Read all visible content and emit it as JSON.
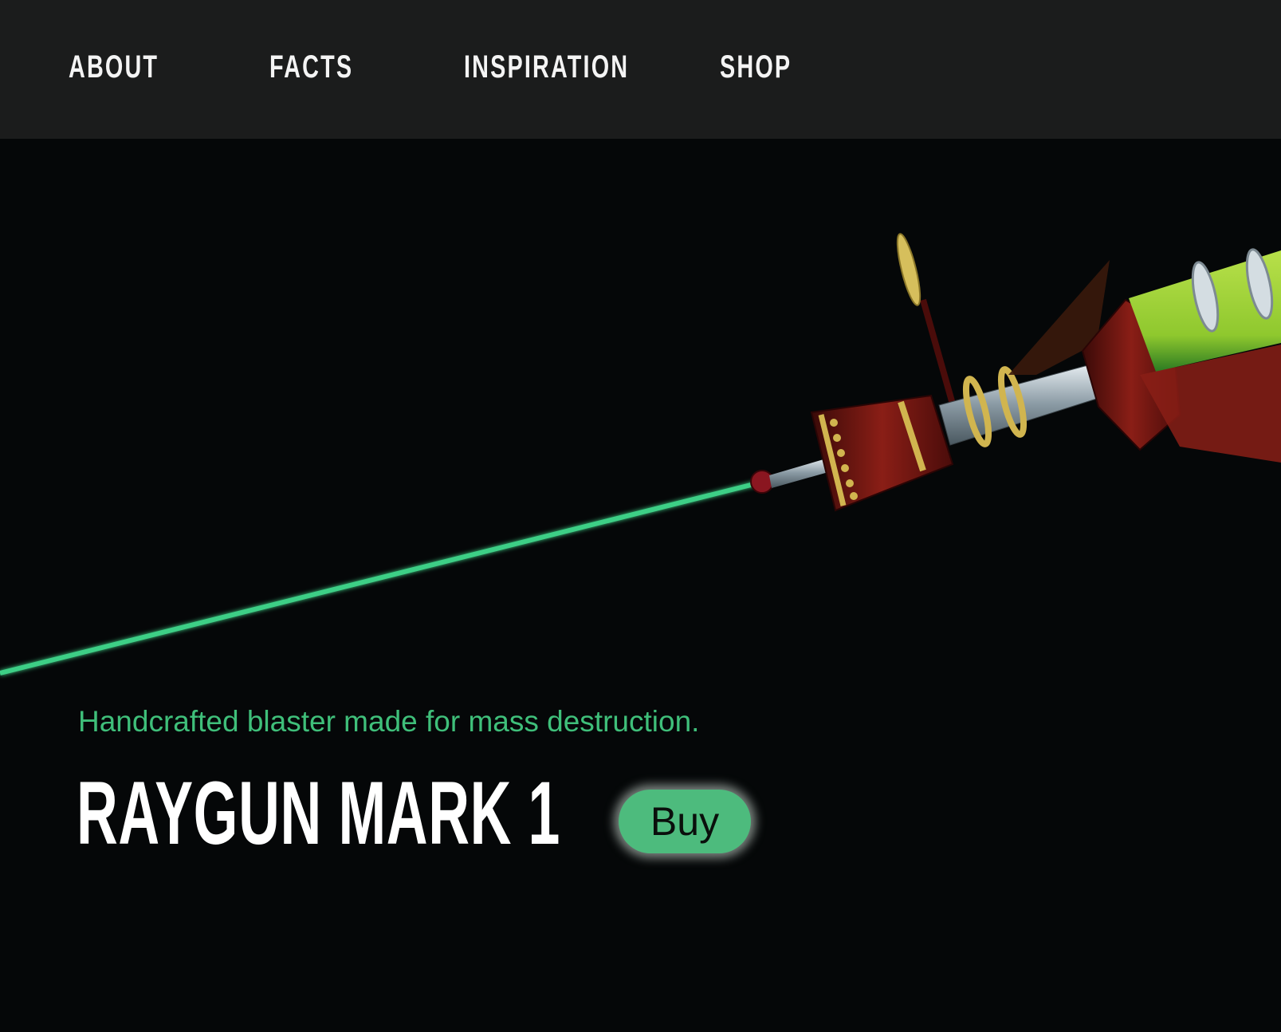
{
  "nav": {
    "items": [
      {
        "label": "ABOUT"
      },
      {
        "label": "FACTS"
      },
      {
        "label": "INSPIRATION"
      },
      {
        "label": "SHOP"
      }
    ]
  },
  "hero": {
    "image_icon": "raygun-illustration",
    "tagline": "Handcrafted blaster made for mass destruction.",
    "title": "RAYGUN MARK 1",
    "buy_label": "Buy"
  },
  "colors": {
    "nav_background": "#1b1c1c",
    "page_background": "#050708",
    "accent_green": "#3fbf7a",
    "button_green": "#4dbb7d",
    "beam_green": "#3ccf86",
    "gun_body_green": "#9acd32"
  }
}
